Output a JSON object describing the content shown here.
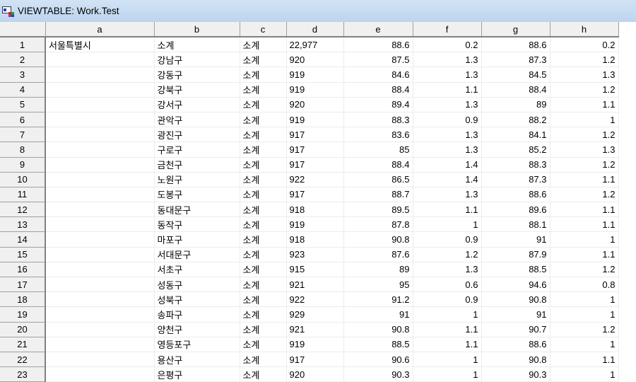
{
  "window": {
    "title": "VIEWTABLE: Work.Test",
    "icon": "sas-viewtable-icon"
  },
  "columns": [
    "a",
    "b",
    "c",
    "d",
    "e",
    "f",
    "g",
    "h"
  ],
  "rows": [
    [
      "1",
      "서울특별시",
      "소계",
      "소계",
      "22,977",
      "88.6",
      "0.2",
      "88.6",
      "0.2"
    ],
    [
      "2",
      "",
      "강남구",
      "소계",
      "920",
      "87.5",
      "1.3",
      "87.3",
      "1.2"
    ],
    [
      "3",
      "",
      "강동구",
      "소계",
      "919",
      "84.6",
      "1.3",
      "84.5",
      "1.3"
    ],
    [
      "4",
      "",
      "강북구",
      "소계",
      "919",
      "88.4",
      "1.1",
      "88.4",
      "1.2"
    ],
    [
      "5",
      "",
      "강서구",
      "소계",
      "920",
      "89.4",
      "1.3",
      "89",
      "1.1"
    ],
    [
      "6",
      "",
      "관악구",
      "소계",
      "919",
      "88.3",
      "0.9",
      "88.2",
      "1"
    ],
    [
      "7",
      "",
      "광진구",
      "소계",
      "917",
      "83.6",
      "1.3",
      "84.1",
      "1.2"
    ],
    [
      "8",
      "",
      "구로구",
      "소계",
      "917",
      "85",
      "1.3",
      "85.2",
      "1.3"
    ],
    [
      "9",
      "",
      "금천구",
      "소계",
      "917",
      "88.4",
      "1.4",
      "88.3",
      "1.2"
    ],
    [
      "10",
      "",
      "노원구",
      "소계",
      "922",
      "86.5",
      "1.4",
      "87.3",
      "1.1"
    ],
    [
      "11",
      "",
      "도봉구",
      "소계",
      "917",
      "88.7",
      "1.3",
      "88.6",
      "1.2"
    ],
    [
      "12",
      "",
      "동대문구",
      "소계",
      "918",
      "89.5",
      "1.1",
      "89.6",
      "1.1"
    ],
    [
      "13",
      "",
      "동작구",
      "소계",
      "919",
      "87.8",
      "1",
      "88.1",
      "1.1"
    ],
    [
      "14",
      "",
      "마포구",
      "소계",
      "918",
      "90.8",
      "0.9",
      "91",
      "1"
    ],
    [
      "15",
      "",
      "서대문구",
      "소계",
      "923",
      "87.6",
      "1.2",
      "87.9",
      "1.1"
    ],
    [
      "16",
      "",
      "서초구",
      "소계",
      "915",
      "89",
      "1.3",
      "88.5",
      "1.2"
    ],
    [
      "17",
      "",
      "성동구",
      "소계",
      "921",
      "95",
      "0.6",
      "94.6",
      "0.8"
    ],
    [
      "18",
      "",
      "성북구",
      "소계",
      "922",
      "91.2",
      "0.9",
      "90.8",
      "1"
    ],
    [
      "19",
      "",
      "송파구",
      "소계",
      "929",
      "91",
      "1",
      "91",
      "1"
    ],
    [
      "20",
      "",
      "양천구",
      "소계",
      "921",
      "90.8",
      "1.1",
      "90.7",
      "1.2"
    ],
    [
      "21",
      "",
      "영등포구",
      "소계",
      "919",
      "88.5",
      "1.1",
      "88.6",
      "1"
    ],
    [
      "22",
      "",
      "용산구",
      "소계",
      "917",
      "90.6",
      "1",
      "90.8",
      "1.1"
    ],
    [
      "23",
      "",
      "은평구",
      "소계",
      "920",
      "90.3",
      "1",
      "90.3",
      "1"
    ]
  ]
}
